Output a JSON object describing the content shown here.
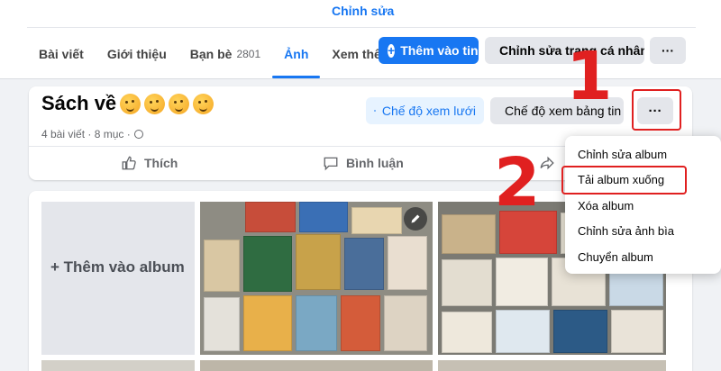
{
  "profile": {
    "edit_link": "Chỉnh sửa",
    "tabs": [
      {
        "label": "Bài viết"
      },
      {
        "label": "Giới thiệu"
      },
      {
        "label": "Bạn bè",
        "count": "2801"
      },
      {
        "label": "Ảnh",
        "active": true
      },
      {
        "label": "Xem thêm"
      }
    ],
    "add_story": "Thêm vào tin",
    "edit_profile": "Chỉnh sửa trang cá nhân",
    "more": "···"
  },
  "album": {
    "title": "Sách về",
    "meta": "4 bài viết · 8 mục ·",
    "grid_view": "Chế độ xem lưới",
    "feed_view": "Chế độ xem bảng tin",
    "more": "···",
    "like": "Thích",
    "comment": "Bình luận",
    "add_tile": "+ Thêm vào album"
  },
  "menu": {
    "items": [
      "Chỉnh sửa album",
      "Tải album xuống",
      "Xóa album",
      "Chỉnh sửa ảnh bìa",
      "Chuyển album"
    ]
  },
  "annotations": {
    "step1": "1",
    "step2": "2",
    "color": "#e02020"
  },
  "colors": {
    "brand_blue": "#1877f2",
    "light_blue_bg": "#e7f3ff",
    "gray_button": "#e4e6eb",
    "page_bg": "#f0f2f5"
  }
}
